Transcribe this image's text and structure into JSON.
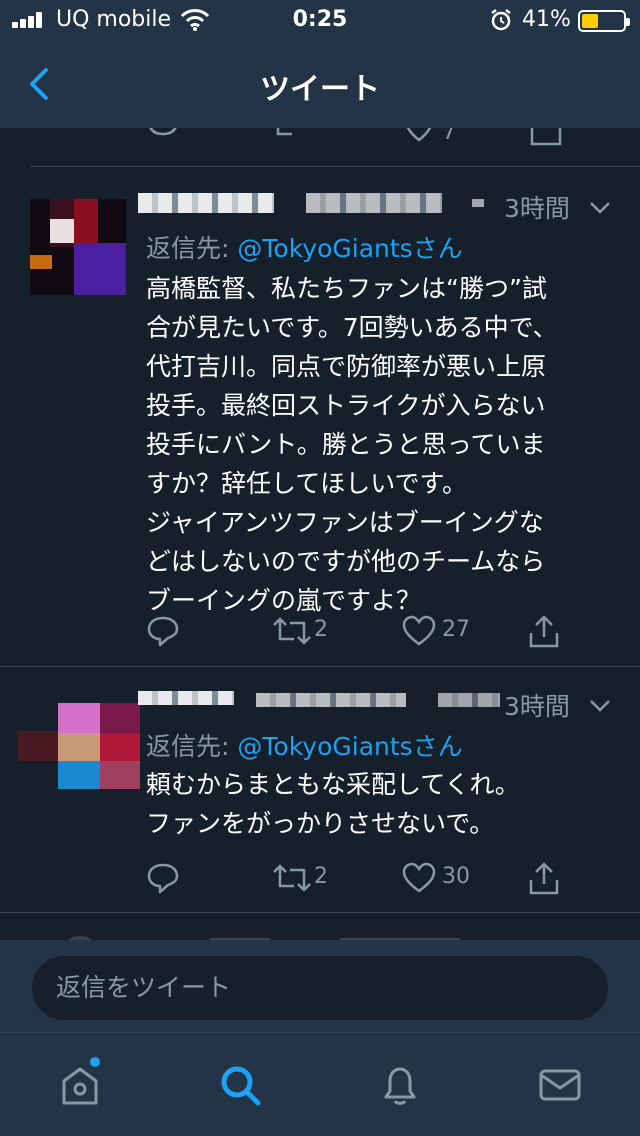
{
  "status_bar": {
    "carrier": "UQ mobile",
    "time": "0:25",
    "battery_percent": "41%",
    "battery_level": 0.41,
    "battery_color": "#ffcc00"
  },
  "nav": {
    "title": "ツイート"
  },
  "partial_tweet": {
    "like_count": "7"
  },
  "tweets": [
    {
      "time_ago": "3時間",
      "reply_prefix": "返信先: ",
      "reply_handle": "@TokyoGiants",
      "reply_suffix": "さん",
      "text": "高橋監督、私たちファンは“勝つ”試\n合が見たいです。7回勢いある中で、\n代打吉川。同点で防御率が悪い上原\n投手。最終回ストライクが入らない\n投手にバント。勝とうと思っていま\nすか？辞任してほしいです。\nジャイアンツファンはブーイングな\nどはしないのですが他のチームなら\nブーイングの嵐ですよ？",
      "retweets": "2",
      "likes": "27"
    },
    {
      "time_ago": "3時間",
      "reply_prefix": "返信先: ",
      "reply_handle": "@TokyoGiants",
      "reply_suffix": "さん",
      "text": "頼むからまともな采配してくれ。\nファンをがっかりさせないで。",
      "retweets": "2",
      "likes": "30"
    }
  ],
  "reply_box": {
    "placeholder": "返信をツイート"
  },
  "colors": {
    "background": "#15202b",
    "bar": "#243447",
    "accent": "#1da1f2",
    "muted": "#8899a6"
  },
  "tabs": [
    "home-icon",
    "search-icon",
    "notifications-icon",
    "messages-icon"
  ]
}
